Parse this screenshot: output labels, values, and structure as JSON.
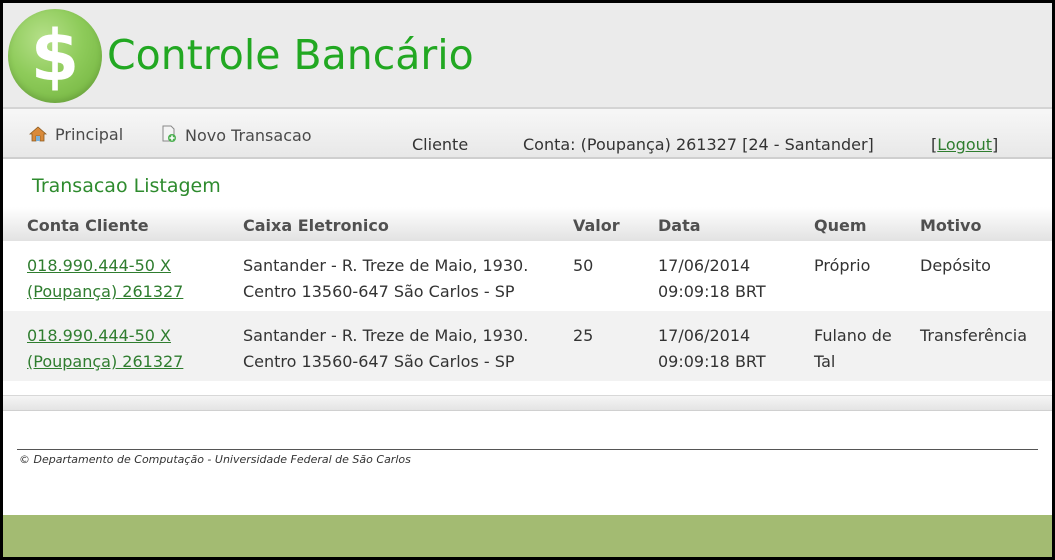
{
  "header": {
    "logo_glyph": "$",
    "title": "Controle Bancário",
    "colors": {
      "title": "#22a822",
      "logo": "#8ecb5a"
    }
  },
  "nav": {
    "items": [
      {
        "label": "Principal",
        "icon": "home-icon"
      },
      {
        "label": "Novo Transacao",
        "icon": "new-document-icon"
      }
    ],
    "client_label": "Cliente",
    "account_info": "Conta: (Poupança) 261327 [24 - Santander]",
    "logout_open": "[",
    "logout_label": "Logout",
    "logout_close": "]"
  },
  "main": {
    "title": "Transacao Listagem",
    "table": {
      "headers": [
        "Conta Cliente",
        "Caixa Eletronico",
        "Valor",
        "Data",
        "Quem",
        "Motivo"
      ],
      "rows": [
        {
          "conta_line1": "018.990.444-50 X",
          "conta_line2": "(Poupança) 261327",
          "caixa_line1": "Santander - R. Treze de Maio, 1930.",
          "caixa_line2": "Centro 13560-647 São Carlos - SP",
          "valor": "50",
          "data_line1": "17/06/2014",
          "data_line2": "09:09:18 BRT",
          "quem_line1": "Próprio",
          "quem_line2": "",
          "motivo": "Depósito"
        },
        {
          "conta_line1": "018.990.444-50 X",
          "conta_line2": "(Poupança) 261327",
          "caixa_line1": "Santander - R. Treze de Maio, 1930.",
          "caixa_line2": "Centro 13560-647 São Carlos - SP",
          "valor": "25",
          "data_line1": "17/06/2014",
          "data_line2": "09:09:18 BRT",
          "quem_line1": "Fulano de",
          "quem_line2": "Tal",
          "motivo": "Transferência"
        }
      ]
    }
  },
  "footer": {
    "text": "© Departamento de Computação - Universidade Federal de São Carlos",
    "bar_color": "#a3bb72"
  }
}
